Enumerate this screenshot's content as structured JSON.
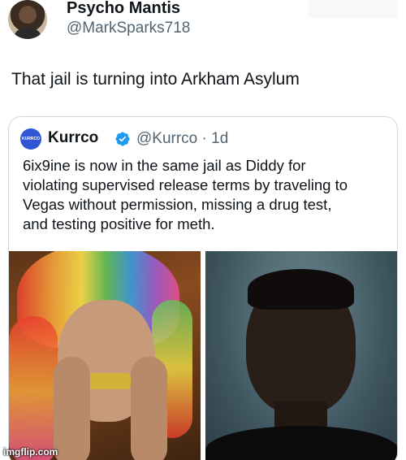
{
  "post": {
    "author_name": "Psycho Mantis",
    "author_handle": "@MarkSparks718",
    "text": "That jail is turning into Arkham Asylum"
  },
  "quote": {
    "author_name": "Kurrco",
    "author_handle": "@Kurrco · 1d",
    "avatar_text": "KURRCO",
    "text_lines": [
      "6ix9ine is now in the same jail as Diddy for",
      "violating supervised release terms by traveling to",
      "Vegas without permission, missing a drug test,",
      "and testing positive for meth."
    ]
  },
  "watermark": "imgflip.com",
  "colors": {
    "verified": "#1d9bf0",
    "handle_gray": "#536471",
    "border": "#cfd9de"
  },
  "icons": {
    "verified": "verified-badge-icon"
  }
}
